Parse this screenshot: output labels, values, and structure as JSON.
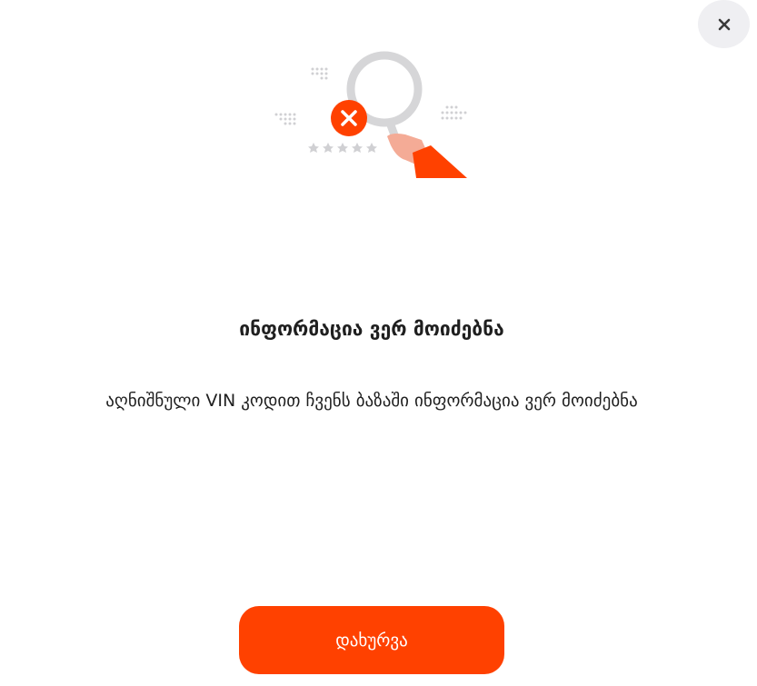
{
  "dialog": {
    "close_icon": "close-icon",
    "illustration_icon": "magnifier-not-found-icon",
    "title": "ინფორმაცია ვერ მოიძებნა",
    "message": "აღნიშნული VIN კოდით ჩვენს ბაზაში ინფორმაცია ვერ მოიძებნა",
    "close_button_label": "დახურვა"
  },
  "colors": {
    "accent": "#ff4100",
    "close_bg": "#efeff2",
    "text": "#1f1f1f",
    "lens_ring": "#d6d6d8",
    "hand": "#f4ab96",
    "dots": "#d0d0d3"
  }
}
